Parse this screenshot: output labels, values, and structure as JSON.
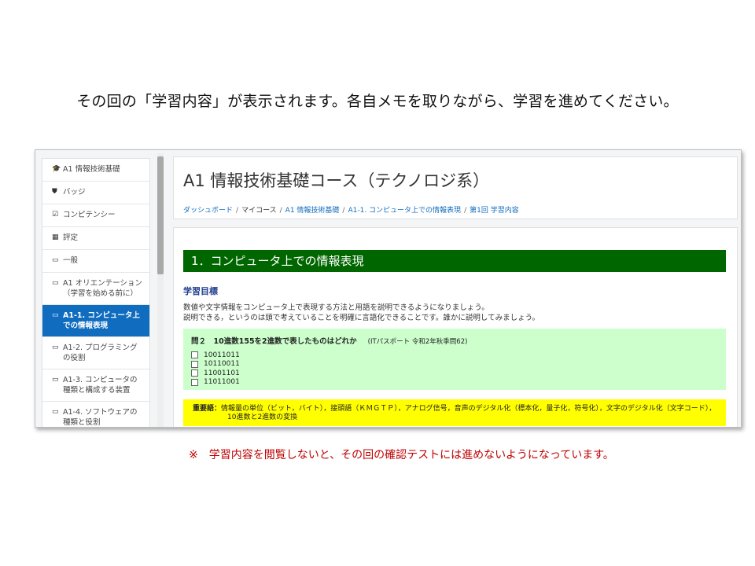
{
  "slide": {
    "headline": "その回の「学習内容」が表示されます。各自メモを取りながら、学習を進めてください。",
    "footnote": "※　学習内容を閲覧しないと、その回の確認テストには進めないようになっています。"
  },
  "sidebar": {
    "items": [
      {
        "icon": "graduation-cap-icon",
        "glyph": "🎓",
        "label": "A1 情報技術基礎"
      },
      {
        "icon": "shield-icon",
        "glyph": "⛊",
        "label": "バッジ"
      },
      {
        "icon": "checkbox-icon",
        "glyph": "☑",
        "label": "コンピテンシー"
      },
      {
        "icon": "table-icon",
        "glyph": "▦",
        "label": "評定"
      },
      {
        "icon": "folder-icon",
        "glyph": "▭",
        "label": "一般"
      },
      {
        "icon": "folder-icon",
        "glyph": "▭",
        "label": "A1 オリエンテーション\n（学習を始める前に）"
      },
      {
        "icon": "folder-icon",
        "glyph": "▭",
        "label": "A1-1. コンピュータ上\nでの情報表現",
        "active": true
      },
      {
        "icon": "folder-icon",
        "glyph": "▭",
        "label": "A1-2. プログラミング\nの役割"
      },
      {
        "icon": "folder-icon",
        "glyph": "▭",
        "label": "A1-3. コンピュータの\n種類と構成する装置"
      },
      {
        "icon": "folder-icon",
        "glyph": "▭",
        "label": "A1-4. ソフトウェアの\n種類と役割"
      }
    ]
  },
  "header": {
    "title": "A1 情報技術基礎コース（テクノロジ系）",
    "breadcrumb": [
      "ダッシュボード",
      "マイコース",
      "A1 情報技術基礎",
      "A1-1. コンピュータ上での情報表現",
      "第1回 学習内容"
    ]
  },
  "content": {
    "section_title": "1．コンピュータ上での情報表現",
    "goals_heading": "学習目標",
    "goals_lines": [
      "数値や文字情報をコンピュータ上で表現する方法と用語を説明できるようになりましょう。",
      "説明できる，というのは頭で考えていることを明確に言語化できることです。誰かに説明してみましょう。"
    ],
    "quiz": {
      "question": "問２　10進数155を2進数で表したものはどれか",
      "source": "(ITパスポート 令和2年秋季問62)",
      "options": [
        "10011011",
        "10110011",
        "11001101",
        "11011001"
      ]
    },
    "terms": {
      "label": "重要語：",
      "line1": "情報量の単位（ビット，バイト），接頭語（ＫＭＧＴＰ），アナログ信号，音声のデジタル化（標本化，量子化，符号化），文字のデジタル化（文字コード），",
      "line2": "10進数と2進数の変換"
    }
  }
}
